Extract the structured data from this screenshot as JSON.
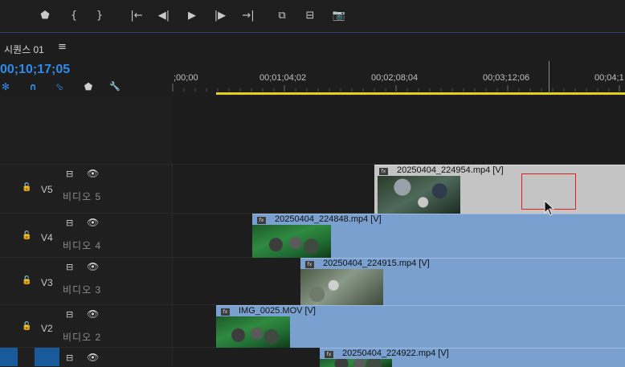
{
  "transport": {
    "buttons": [
      {
        "name": "add-marker-button",
        "glyph": "⬟"
      },
      {
        "name": "mark-in-button",
        "glyph": "{"
      },
      {
        "name": "mark-out-button",
        "glyph": "}"
      },
      {
        "name": "go-to-in-button",
        "glyph": "|←"
      },
      {
        "name": "step-back-button",
        "glyph": "◀|"
      },
      {
        "name": "play-button",
        "glyph": "▶"
      },
      {
        "name": "step-forward-button",
        "glyph": "|▶"
      },
      {
        "name": "go-to-out-button",
        "glyph": "→|"
      },
      {
        "name": "lift-button",
        "glyph": "⧉"
      },
      {
        "name": "extract-button",
        "glyph": "⊟"
      },
      {
        "name": "export-frame-button",
        "glyph": "📷"
      }
    ]
  },
  "sequence": {
    "tab_title": "시퀀스 01",
    "menu_glyph": "≡",
    "timecode": "00;10;17;05"
  },
  "timeline_tools": [
    {
      "name": "snap-icon",
      "glyph": "✻",
      "color": "#2d8ceb"
    },
    {
      "name": "magnet-icon",
      "glyph": "∩",
      "color": "#2d8ceb"
    },
    {
      "name": "linked-selection-icon",
      "glyph": "⬂",
      "color": "#2d8ceb"
    },
    {
      "name": "marker-icon",
      "glyph": "⬟",
      "color": "#cfcfcf"
    },
    {
      "name": "wrench-icon",
      "glyph": "🔧",
      "color": "#cfcfcf"
    }
  ],
  "ruler": {
    "labels": [
      ";00;00",
      "00;01;04;02",
      "00;02;08;04",
      "00;03;12;06",
      "00;04;1"
    ]
  },
  "tracks": [
    {
      "id": "V5",
      "name": "비디오 5"
    },
    {
      "id": "V4",
      "name": "비디오 4"
    },
    {
      "id": "V3",
      "name": "비디오 3"
    },
    {
      "id": "V2",
      "name": "비디오 2"
    }
  ],
  "track_icons": {
    "lock": "🔓",
    "film": "⊟",
    "eye": "👁"
  },
  "clips": [
    {
      "track": "V5",
      "label": "20250404_224954.mp4 [V]"
    },
    {
      "track": "V4",
      "label": "20250404_224848.mp4 [V]"
    },
    {
      "track": "V3",
      "label": "20250404_224915.mp4 [V]"
    },
    {
      "track": "V2",
      "label": "IMG_0025.MOV [V]"
    },
    {
      "track": "V1",
      "label": "20250404_224922.mp4 [V]"
    }
  ],
  "fx_badge": "fx",
  "colors": {
    "accent": "#2d8ceb",
    "clip": "#7aa0d0",
    "workbar": "#e3d21b",
    "selection": "#e02020"
  }
}
